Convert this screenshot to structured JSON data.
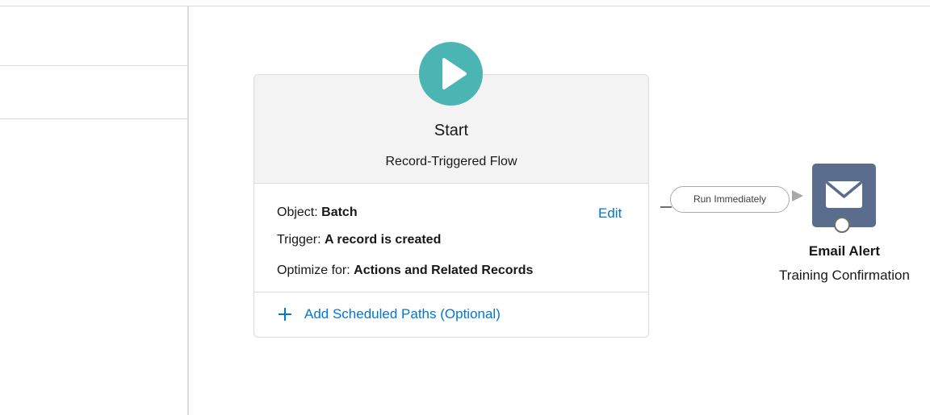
{
  "start": {
    "title": "Start",
    "subtitle": "Record-Triggered Flow",
    "object_label": "Object: ",
    "object_value": "Batch",
    "trigger_label": "Trigger: ",
    "trigger_value": "A record is created",
    "optimize_label": "Optimize for: ",
    "optimize_value": "Actions and Related Records",
    "edit_label": "Edit",
    "add_paths_label": "Add Scheduled Paths (Optional)",
    "icon": "play-icon",
    "icon_color": "#4bb5b4"
  },
  "connector": {
    "label": "Run Immediately"
  },
  "email_alert": {
    "title": "Email Alert",
    "subtitle": "Training Confirmation",
    "icon": "envelope-icon",
    "icon_color": "#5a6d8c"
  },
  "colors": {
    "link": "#0176d3",
    "border": "#dddbda",
    "header_bg": "#f3f3f3"
  }
}
